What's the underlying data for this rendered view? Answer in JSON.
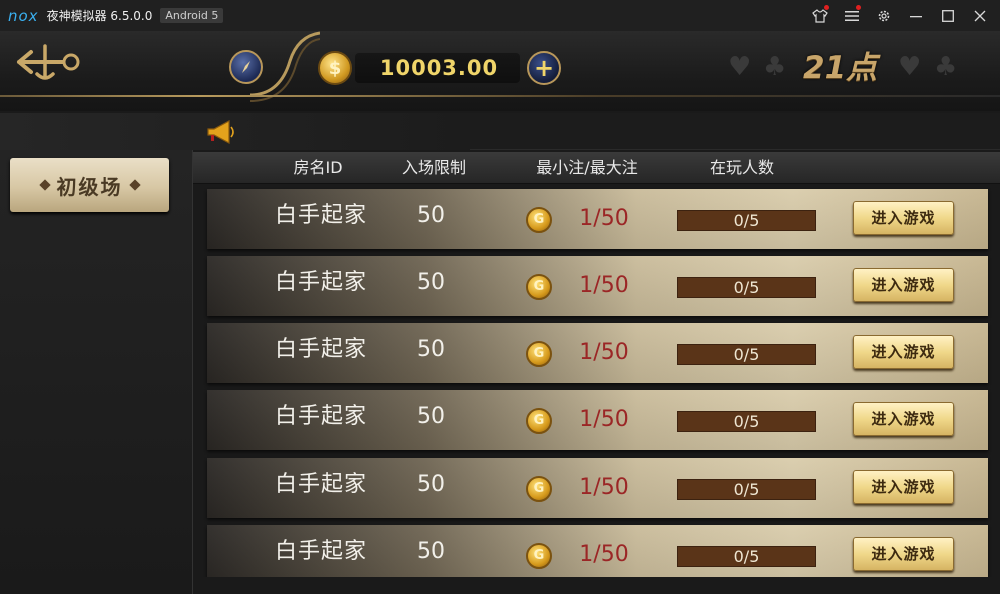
{
  "emulator": {
    "logo": "nox",
    "title": "夜神模拟器 6.5.0.0",
    "android_badge": "Android 5",
    "controls": [
      "shirt-icon",
      "menu-icon",
      "gear-icon",
      "minimize-icon",
      "maximize-icon",
      "close-icon"
    ]
  },
  "header": {
    "balance": "10003.00",
    "game_title": "21点",
    "plus_label": "+"
  },
  "sidebar": {
    "tabs": [
      {
        "label": "初级场",
        "selected": true
      }
    ]
  },
  "table": {
    "columns": [
      "房名ID",
      "入场限制",
      "最小注/最大注",
      "在玩人数"
    ],
    "rows": [
      {
        "name": "白手起家",
        "limit": "50",
        "bet": "1/50",
        "players": "0/5",
        "enter": "进入游戏"
      },
      {
        "name": "白手起家",
        "limit": "50",
        "bet": "1/50",
        "players": "0/5",
        "enter": "进入游戏"
      },
      {
        "name": "白手起家",
        "limit": "50",
        "bet": "1/50",
        "players": "0/5",
        "enter": "进入游戏"
      },
      {
        "name": "白手起家",
        "limit": "50",
        "bet": "1/50",
        "players": "0/5",
        "enter": "进入游戏"
      },
      {
        "name": "白手起家",
        "limit": "50",
        "bet": "1/50",
        "players": "0/5",
        "enter": "进入游戏"
      },
      {
        "name": "白手起家",
        "limit": "50",
        "bet": "1/50",
        "players": "0/5",
        "enter": "进入游戏"
      }
    ]
  },
  "colors": {
    "accent_gold": "#f0d56a",
    "bet_red": "#9b2626",
    "players_bar": "#5a3418"
  }
}
